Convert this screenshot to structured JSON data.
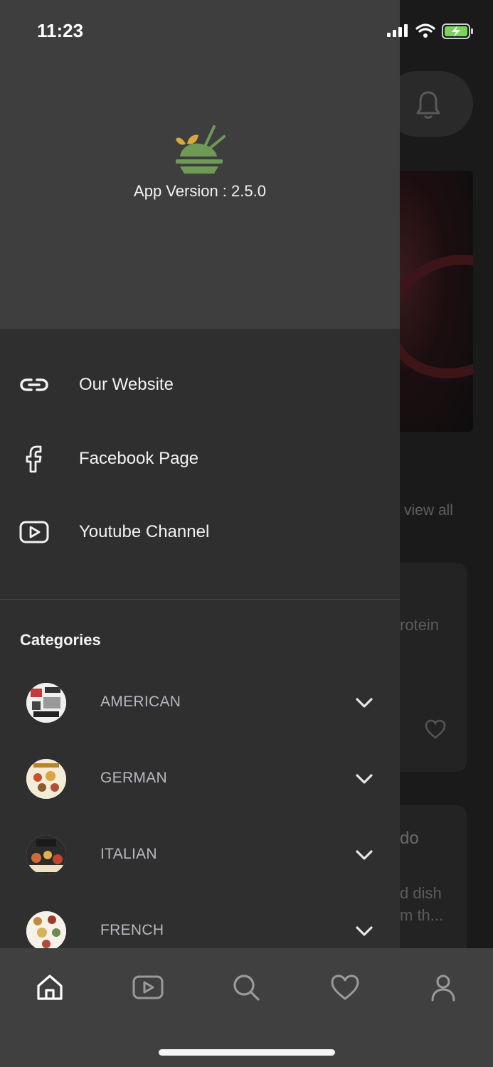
{
  "status_bar": {
    "time": "11:23"
  },
  "drawer": {
    "app_version": "App Version : 2.5.0",
    "links": [
      {
        "label": "Our Website",
        "icon": "link-icon"
      },
      {
        "label": "Facebook Page",
        "icon": "facebook-icon"
      },
      {
        "label": "Youtube Channel",
        "icon": "youtube-icon"
      }
    ],
    "categories_title": "Categories",
    "categories": [
      {
        "label": "AMERICAN",
        "icon": "chevron-down-icon"
      },
      {
        "label": "GERMAN",
        "icon": "chevron-down-icon"
      },
      {
        "label": "ITALIAN",
        "icon": "chevron-down-icon"
      },
      {
        "label": "FRENCH",
        "icon": "chevron-down-icon"
      }
    ]
  },
  "background_screen": {
    "view_all": "view all",
    "card1_text": "rotein",
    "card2_title": "do",
    "card2_line1": "d dish",
    "card2_line2": "m th..."
  },
  "tabbar": {
    "tabs": [
      {
        "icon": "home-icon",
        "active": true
      },
      {
        "icon": "video-icon",
        "active": false
      },
      {
        "icon": "search-icon",
        "active": false
      },
      {
        "icon": "heart-icon",
        "active": false
      },
      {
        "icon": "profile-icon",
        "active": false
      }
    ]
  },
  "colors": {
    "drawer_bg": "#2f2f2f",
    "drawer_header_bg": "#3e3e3e",
    "tabbar_bg": "#404040",
    "logo_green": "#6e9a55",
    "logo_yellow": "#d8a93a"
  }
}
